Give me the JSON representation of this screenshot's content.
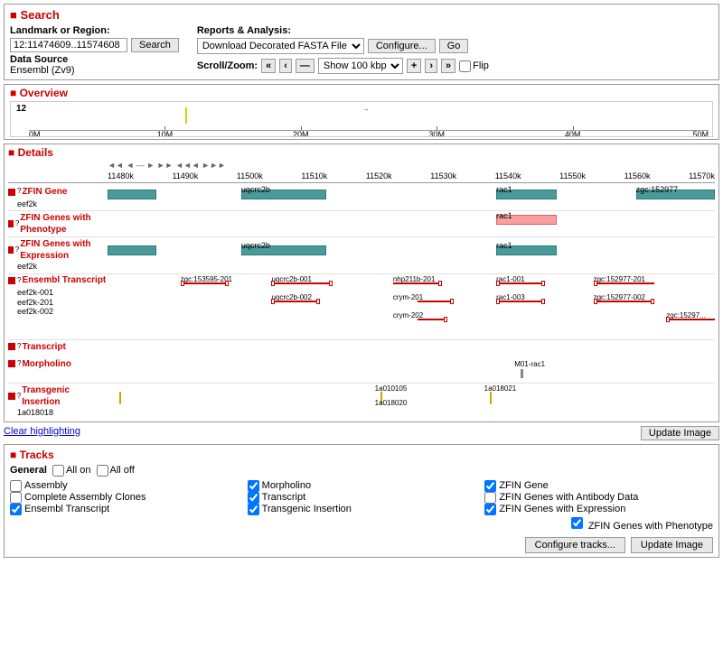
{
  "search": {
    "title": "Search",
    "landmark_label": "Landmark or Region:",
    "landmark_value": "12:11474609..11574608",
    "search_btn": "Search",
    "reports_label": "Reports & Analysis:",
    "reports_select_option": "Download Decorated FASTA File",
    "configure_btn": "Configure...",
    "go_btn": "Go",
    "scroll_zoom_label": "Scroll/Zoom:",
    "show_label": "Show",
    "show_value": "100 kbp",
    "flip_label": "Flip",
    "datasource_label": "Data Source",
    "datasource_value": "Ensembl (Zv9)"
  },
  "overview": {
    "title": "Overview",
    "nav_arrows": "◄◄ ◄ — ► ►► ◄◄◄ ►►►",
    "ruler_labels": [
      "0M",
      "10M",
      "20M",
      "30M",
      "40M",
      "50M"
    ],
    "chromosome": "12",
    "highlight_pos": "~11.5M"
  },
  "details": {
    "title": "Details",
    "ruler_labels": [
      "11480k",
      "11490k",
      "11500k",
      "11510k",
      "11520k",
      "11530k",
      "11540k",
      "11550k",
      "11560k",
      "11570k"
    ],
    "tracks": [
      {
        "name": "ZFIN Gene",
        "sub": "eef2k",
        "type": "gene",
        "genes": [
          {
            "label": "eef2k",
            "start": 0,
            "width": 9,
            "color": "teal"
          },
          {
            "label": "uqcrc2b",
            "start": 20,
            "width": 12,
            "color": "teal"
          },
          {
            "label": "rac1",
            "start": 64,
            "width": 10,
            "color": "teal"
          },
          {
            "label": "zgc:152977",
            "start": 87,
            "width": 13,
            "color": "teal"
          }
        ]
      },
      {
        "name": "ZFIN Genes with Phenotype",
        "type": "phenotype",
        "genes": [
          {
            "label": "rac1",
            "start": 64,
            "width": 10,
            "color": "pink"
          }
        ]
      },
      {
        "name": "ZFIN Genes with Expression",
        "sub": "eef2k",
        "type": "expression",
        "genes": [
          {
            "label": "eef2k",
            "start": 0,
            "width": 9,
            "color": "teal"
          },
          {
            "label": "uqcrc2b",
            "start": 20,
            "width": 12,
            "color": "teal"
          },
          {
            "label": "rac1",
            "start": 64,
            "width": 10,
            "color": "teal"
          }
        ]
      },
      {
        "name": "Ensembl Transcript",
        "sub": "eef2k-001",
        "type": "transcript"
      },
      {
        "name": "Transcript",
        "type": "simple"
      },
      {
        "name": "Morpholino",
        "type": "simple"
      },
      {
        "name": "Transgenic Insertion",
        "sub": "1a018018",
        "type": "insertion"
      }
    ]
  },
  "clear_highlighting": "Clear highlighting",
  "update_image_1": "Update Image",
  "tracks_section": {
    "title": "Tracks",
    "general_label": "General",
    "all_on": "All on",
    "all_off": "All off",
    "items": [
      {
        "label": "Assembly",
        "checked": false,
        "col": 1
      },
      {
        "label": "Complete Assembly Clones",
        "checked": false,
        "col": 1
      },
      {
        "label": "Ensembl Transcript",
        "checked": true,
        "col": 1
      },
      {
        "label": "Morpholino",
        "checked": true,
        "col": 2
      },
      {
        "label": "Transcript",
        "checked": true,
        "col": 2
      },
      {
        "label": "Transgenic Insertion",
        "checked": true,
        "col": 2
      },
      {
        "label": "ZFIN Gene",
        "checked": true,
        "col": 3
      },
      {
        "label": "ZFIN Genes with Antibody Data",
        "checked": false,
        "col": 3
      },
      {
        "label": "ZFIN Genes with Expression",
        "checked": true,
        "col": 3
      },
      {
        "label": "ZFIN Genes with Phenotype",
        "checked": true,
        "col": 4
      }
    ],
    "configure_tracks_btn": "Configure tracks...",
    "update_image_btn": "Update Image"
  }
}
